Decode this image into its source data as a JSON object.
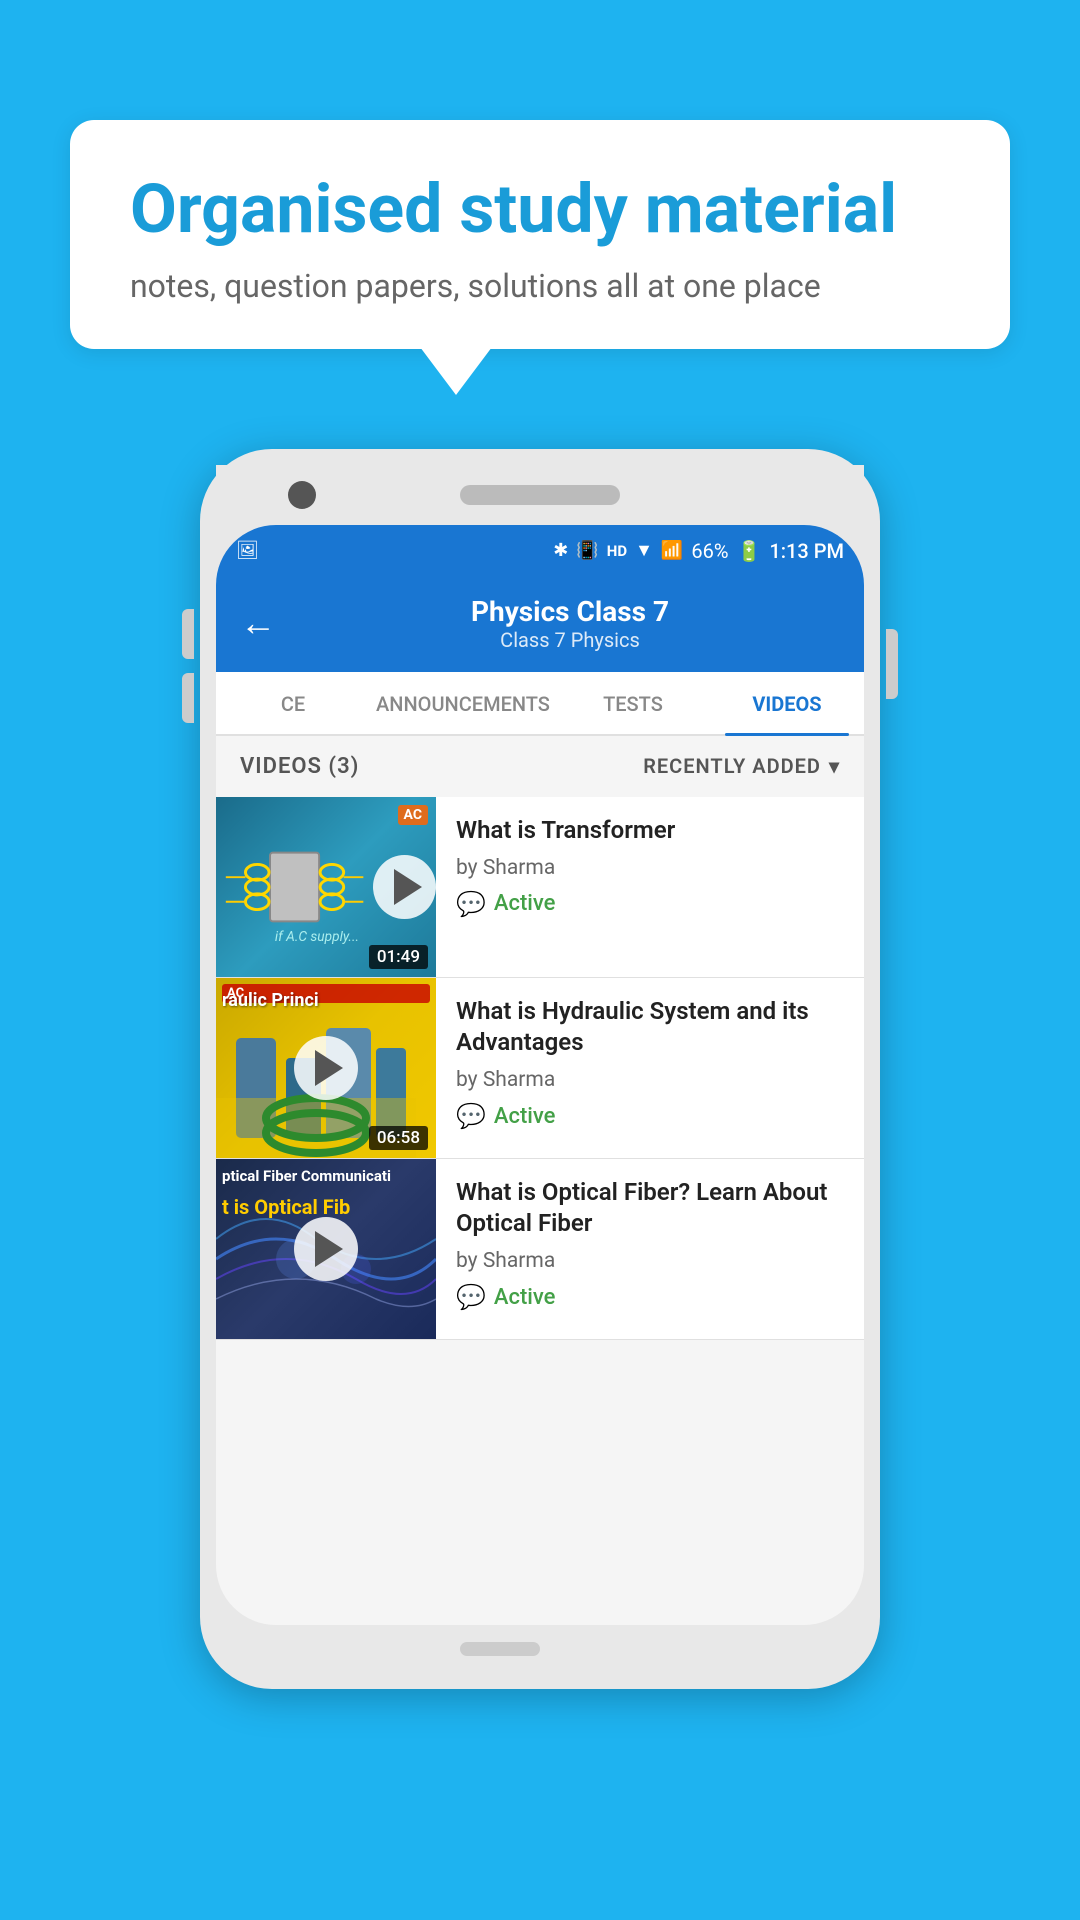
{
  "page": {
    "background_color": "#1eb3f0"
  },
  "speech_bubble": {
    "title": "Organised study material",
    "subtitle": "notes, question papers, solutions all at one place"
  },
  "status_bar": {
    "battery": "66%",
    "time": "1:13 PM",
    "network": "HD"
  },
  "app_bar": {
    "back_label": "←",
    "title": "Physics Class 7",
    "subtitle": "Class 7   Physics"
  },
  "tabs": [
    {
      "label": "CE",
      "active": false
    },
    {
      "label": "ANNOUNCEMENTS",
      "active": false
    },
    {
      "label": "TESTS",
      "active": false
    },
    {
      "label": "VIDEOS",
      "active": true
    }
  ],
  "list_header": {
    "title": "VIDEOS (3)",
    "sort_label": "RECENTLY ADDED",
    "sort_icon": "chevron-down"
  },
  "videos": [
    {
      "title": "What is  Transformer",
      "author": "by Sharma",
      "status": "Active",
      "duration": "01:49",
      "thumb_type": "transformer"
    },
    {
      "title": "What is Hydraulic System and its Advantages",
      "author": "by Sharma",
      "status": "Active",
      "duration": "06:58",
      "thumb_type": "hydraulic",
      "thumb_text": "raulic Princi"
    },
    {
      "title": "What is Optical Fiber? Learn About Optical Fiber",
      "author": "by Sharma",
      "status": "Active",
      "duration": "",
      "thumb_type": "optical",
      "thumb_text_1": "ptical Fiber Communicati",
      "thumb_text_2": "t is Optical Fib"
    }
  ],
  "icons": {
    "play": "▶",
    "chevron_down": "▾",
    "back_arrow": "←",
    "bluetooth": "B",
    "wifi": "W",
    "battery": "🔋",
    "chat": "💬"
  }
}
